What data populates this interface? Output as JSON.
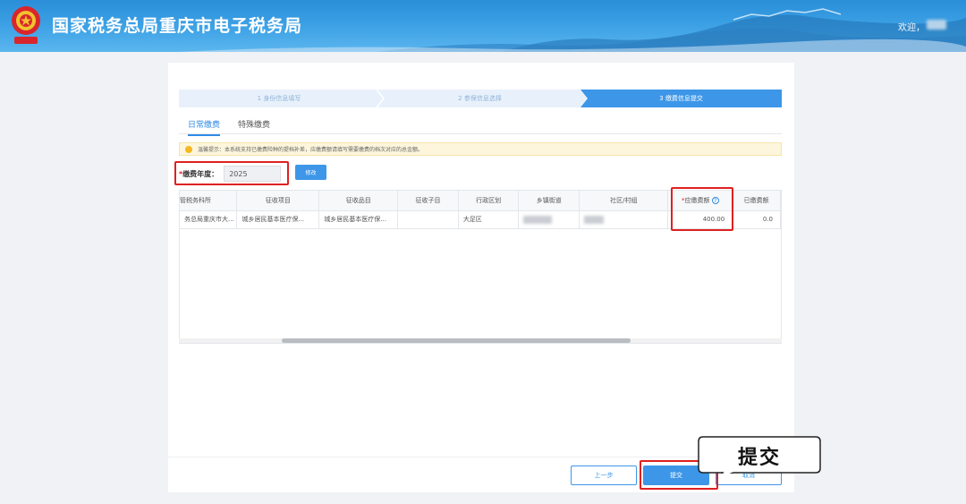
{
  "header": {
    "title": "国家税务总局重庆市电子税务局",
    "welcome": "欢迎，"
  },
  "steps": [
    {
      "label": "1 身份信息填写"
    },
    {
      "label": "2 参保信息选择"
    },
    {
      "label": "3 缴费信息提交"
    }
  ],
  "tabs": [
    {
      "label": "日常缴费"
    },
    {
      "label": "特殊缴费"
    }
  ],
  "notice": "温馨提示：本系统支持已缴费险种的提档补差，应缴费额请填写需要缴费的档次对应的总金额。",
  "year": {
    "label": "缴费年度：",
    "value": "2025",
    "modify_label": "修改"
  },
  "table": {
    "columns": [
      "管税务科所",
      "征收项目",
      "征收品目",
      "征收子目",
      "行政区划",
      "乡镇街道",
      "社区/村组",
      "应缴费额",
      "已缴费额"
    ],
    "rows": [
      {
        "tax_office": "务总局重庆市大...",
        "item": "城乡居民基本医疗保...",
        "category": "城乡居民基本医疗保...",
        "subitem": "",
        "district": "大足区",
        "amount_due": "400.00",
        "amount_paid": "0.0"
      }
    ]
  },
  "buttons": {
    "prev": "上一步",
    "submit": "提交",
    "cancel": "取消"
  },
  "callout": "提交"
}
